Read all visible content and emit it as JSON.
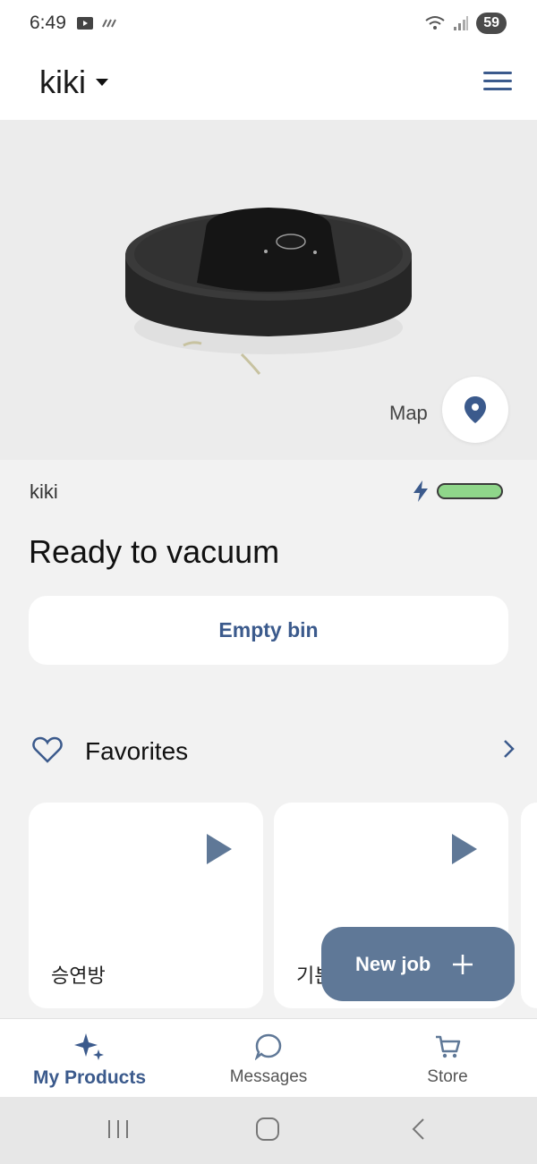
{
  "status_bar": {
    "time": "6:49",
    "battery": "59"
  },
  "header": {
    "robot_name": "kiki",
    "dropdown_icon": "caret-down-icon",
    "menu_icon": "hamburger-menu-icon"
  },
  "hero": {
    "map_label": "Map",
    "map_icon": "location-pin-icon"
  },
  "robot": {
    "name": "kiki",
    "status": "Ready to vacuum",
    "charging_icon": "lightning-bolt-icon",
    "battery_level": 1.0,
    "battery_color": "#8fd68a"
  },
  "actions": {
    "empty_bin_label": "Empty bin"
  },
  "favorites": {
    "title": "Favorites",
    "items": [
      {
        "label": "승연방"
      },
      {
        "label": "기본"
      }
    ]
  },
  "fab": {
    "label": "New job",
    "icon": "plus-icon"
  },
  "bottom_nav": {
    "items": [
      {
        "label": "My Products",
        "icon": "sparkle-icon",
        "active": true
      },
      {
        "label": "Messages",
        "icon": "chat-bubble-icon",
        "active": false
      },
      {
        "label": "Store",
        "icon": "cart-icon",
        "active": false
      }
    ]
  },
  "colors": {
    "accent": "#3b5a8c",
    "fab": "#5f7897",
    "background": "#f2f2f2"
  }
}
